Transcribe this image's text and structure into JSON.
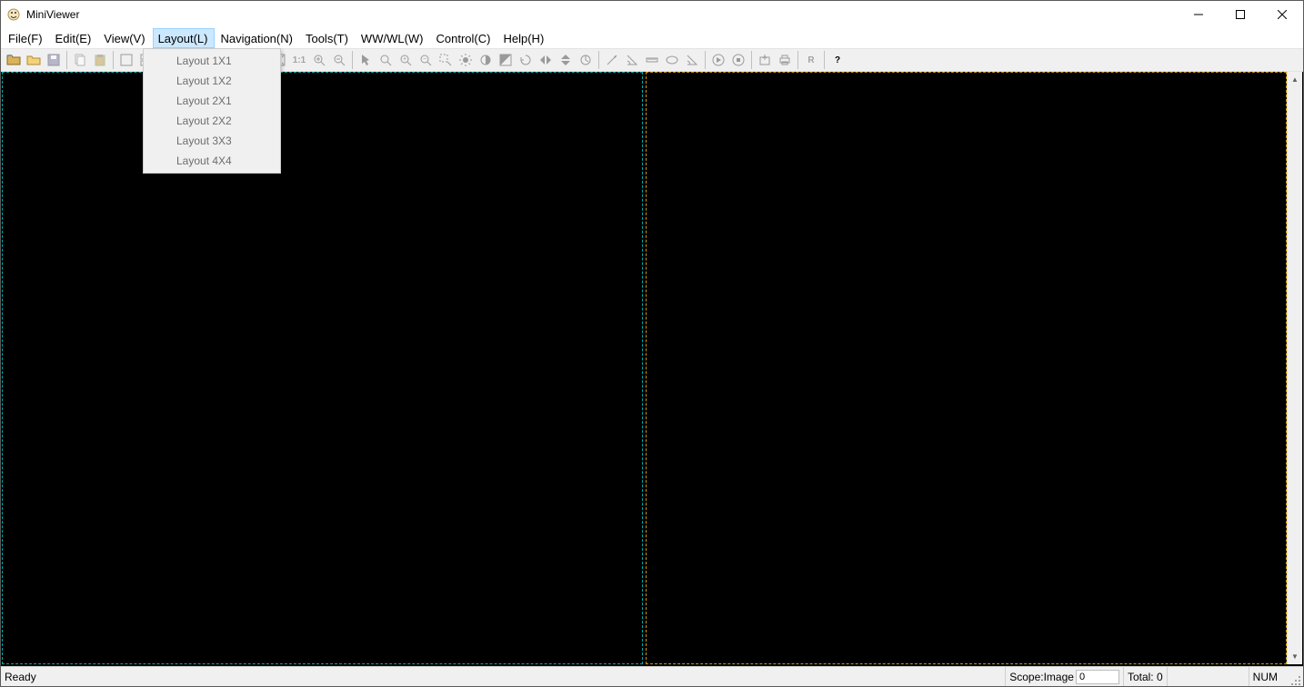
{
  "app": {
    "title": "MiniViewer"
  },
  "menus": {
    "file": "File(F)",
    "edit": "Edit(E)",
    "view": "View(V)",
    "layout": "Layout(L)",
    "nav": "Navigation(N)",
    "tools": "Tools(T)",
    "wwwl": "WW/WL(W)",
    "control": "Control(C)",
    "help": "Help(H)"
  },
  "layout_menu": {
    "items": [
      "Layout 1X1",
      "Layout 1X2",
      "Layout 2X1",
      "Layout 2X2",
      "Layout 3X3",
      "Layout 4X4"
    ]
  },
  "toolbar": {
    "icons": [
      {
        "name": "open-folder-alt-icon",
        "enabled": true
      },
      {
        "name": "open-folder-icon",
        "enabled": true
      },
      {
        "name": "save-icon",
        "enabled": false
      },
      {
        "name": "sep"
      },
      {
        "name": "copy-icon",
        "enabled": false
      },
      {
        "name": "paste-icon",
        "enabled": false
      },
      {
        "name": "sep"
      },
      {
        "name": "layout-single-icon",
        "enabled": false
      },
      {
        "name": "layout-grid-icon",
        "enabled": false
      },
      {
        "name": "sep"
      },
      {
        "name": "first-icon",
        "enabled": false
      },
      {
        "name": "prev-icon",
        "enabled": false
      },
      {
        "name": "play-icon",
        "enabled": false
      },
      {
        "name": "next-icon",
        "enabled": false
      },
      {
        "name": "last-icon",
        "enabled": false
      },
      {
        "name": "sep"
      },
      {
        "name": "fit-icon",
        "enabled": false
      },
      {
        "name": "scale-1-1-icon",
        "enabled": false,
        "glyph": "1:1"
      },
      {
        "name": "zoom-in-icon",
        "enabled": false
      },
      {
        "name": "zoom-out-icon",
        "enabled": false
      },
      {
        "name": "sep"
      },
      {
        "name": "pointer-icon",
        "enabled": false
      },
      {
        "name": "pan-icon",
        "enabled": false
      },
      {
        "name": "magnify-plus-icon",
        "enabled": false
      },
      {
        "name": "magnify-minus-icon",
        "enabled": false
      },
      {
        "name": "region-zoom-icon",
        "enabled": false
      },
      {
        "name": "brightness-icon",
        "enabled": false
      },
      {
        "name": "contrast-icon",
        "enabled": false
      },
      {
        "name": "invert-icon",
        "enabled": false
      },
      {
        "name": "rotate-icon",
        "enabled": false
      },
      {
        "name": "flip-h-icon",
        "enabled": false
      },
      {
        "name": "flip-v-icon",
        "enabled": false
      },
      {
        "name": "reset-icon",
        "enabled": false
      },
      {
        "name": "sep"
      },
      {
        "name": "arrow-tool-icon",
        "enabled": false
      },
      {
        "name": "angle-icon",
        "enabled": false
      },
      {
        "name": "ruler-icon",
        "enabled": false
      },
      {
        "name": "ellipse-icon",
        "enabled": false
      },
      {
        "name": "rectangle-icon",
        "enabled": false
      },
      {
        "name": "sep"
      },
      {
        "name": "cine-play-icon",
        "enabled": false
      },
      {
        "name": "cine-stop-icon",
        "enabled": false
      },
      {
        "name": "sep"
      },
      {
        "name": "export-icon",
        "enabled": false
      },
      {
        "name": "print-icon",
        "enabled": false
      },
      {
        "name": "sep"
      },
      {
        "name": "r-icon",
        "enabled": false,
        "glyph": "R"
      },
      {
        "name": "sep"
      },
      {
        "name": "help-icon",
        "enabled": true,
        "glyph": "?"
      }
    ]
  },
  "status": {
    "ready": "Ready",
    "scope_label": "Scope:Image",
    "scope_value": "0",
    "total_label": "Total:",
    "total_value": "0",
    "num": "NUM"
  }
}
